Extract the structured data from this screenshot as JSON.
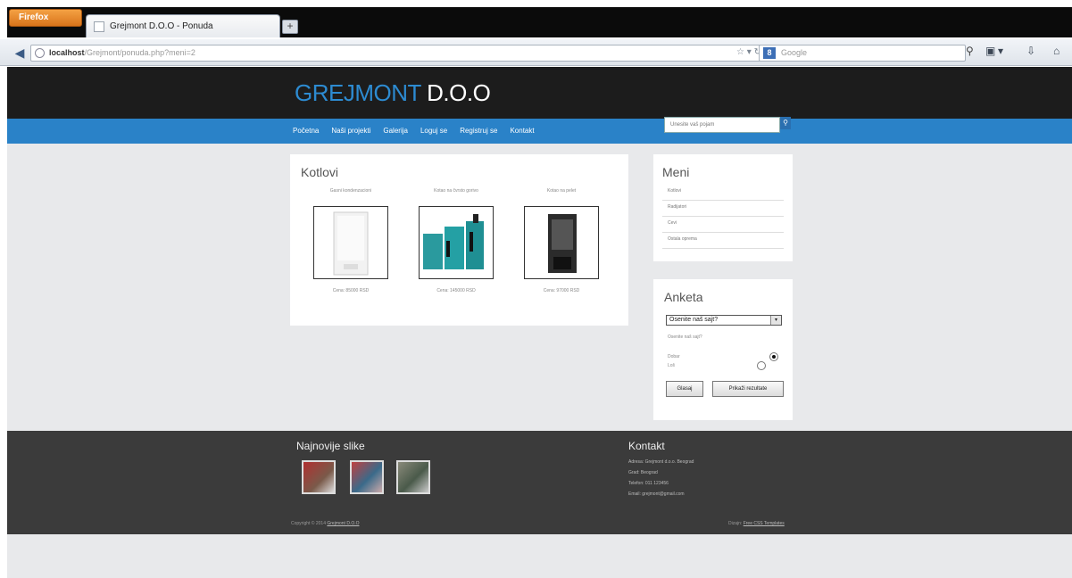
{
  "browser": {
    "app_button": "Firefox",
    "tab_title": "Grejmont D.O.O - Ponuda",
    "new_tab": "+",
    "url_host": "localhost",
    "url_path": "/Grejmont/ponuda.php?meni=2",
    "search_engine": "8",
    "search_placeholder": "Google",
    "icons": [
      "back-arrow-icon",
      "bookmark-star-icon",
      "reload-icon",
      "search-icon",
      "window-icon",
      "download-icon",
      "home-icon"
    ]
  },
  "site": {
    "logo_part1": "GREJMONT",
    "logo_part2": " D.O.O",
    "nav": [
      "Početna",
      "Naši projekti",
      "Galerija",
      "Loguj se",
      "Registruj se",
      "Kontakt"
    ],
    "search_placeholder": "Unesite vaš pojam",
    "colors": {
      "header": "#1c1c1c",
      "menubar": "#2a82c8",
      "logo_accent": "#2d8bd1",
      "footer": "#3b3b3b"
    }
  },
  "main": {
    "title": "Kotlovi",
    "products": [
      {
        "name": "Gasni kondenzacioni",
        "price": "Cena: 85000 RSD"
      },
      {
        "name": "Kotao na čvrsto gorivo",
        "price": "Cena: 145000 RSD"
      },
      {
        "name": "Kotao na pelet",
        "price": "Cena: 97000 RSD"
      }
    ]
  },
  "sidebar": {
    "menu_title": "Meni",
    "menu_items": [
      "Kotlovi",
      "Radijatori",
      "Cevi",
      "Ostala oprema"
    ],
    "poll_title": "Anketa",
    "poll_selected": "Osenite naš sajt?",
    "poll_question": "Osenite naš sajt?",
    "poll_options": [
      "Dobar",
      "Loš"
    ],
    "vote_label": "Glasaj",
    "results_label": "Prikaži rezultate"
  },
  "footer": {
    "gallery_title": "Najnovije slike",
    "contact_title": "Kontakt",
    "contact_lines": [
      "Adresa: Grejmont d.o.o. Beograd",
      "Grad: Beograd",
      "Telefon: 011 123456",
      "Email: grejmont@gmail.com"
    ],
    "copyright_prefix": "Copyright © 2014",
    "copyright_link": "Grejmont D.O.O",
    "design_prefix": "Dizajn:",
    "design_link": "Free CSS Templates"
  }
}
